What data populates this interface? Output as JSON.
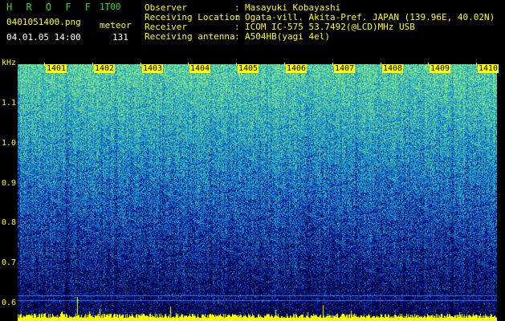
{
  "header": {
    "app_title": "H R O F F T",
    "version": "1.00",
    "file_name": "0401051400.png",
    "count_label": "meteor",
    "date_time": "04.01.05 14:00",
    "count_value": "131"
  },
  "info": [
    {
      "label": "Observer",
      "value": "Masayuki Kobayashi"
    },
    {
      "label": "Receiving Location",
      "value": "Ogata-vill. Akita-Pref. JAPAN (139.96E, 40.02N)"
    },
    {
      "label": "Receiver",
      "value": "ICOM IC-575 53.7492(@LCD)MHz USB"
    },
    {
      "label": "Receiving antenna",
      "value": "A504HB(yagi 4el)"
    }
  ],
  "axis": {
    "y_unit": "kHz",
    "y_ticks": [
      "1.1",
      "1.0",
      "0.9",
      "0.8",
      "0.7",
      "0.6"
    ],
    "x_ticks": [
      "1401",
      "1402",
      "1403",
      "1404",
      "1405",
      "1406",
      "1407",
      "1408",
      "1409",
      "1410"
    ]
  },
  "colors": {
    "background": "#000000",
    "label_green": "#33d633",
    "axis_yellow": "#ffff00",
    "text_white": "#ffffff",
    "noise_low": "#000033",
    "noise_mid": "#0a3cc8",
    "noise_high": "#28c8a0",
    "signal_bar": "#ffff00"
  }
}
